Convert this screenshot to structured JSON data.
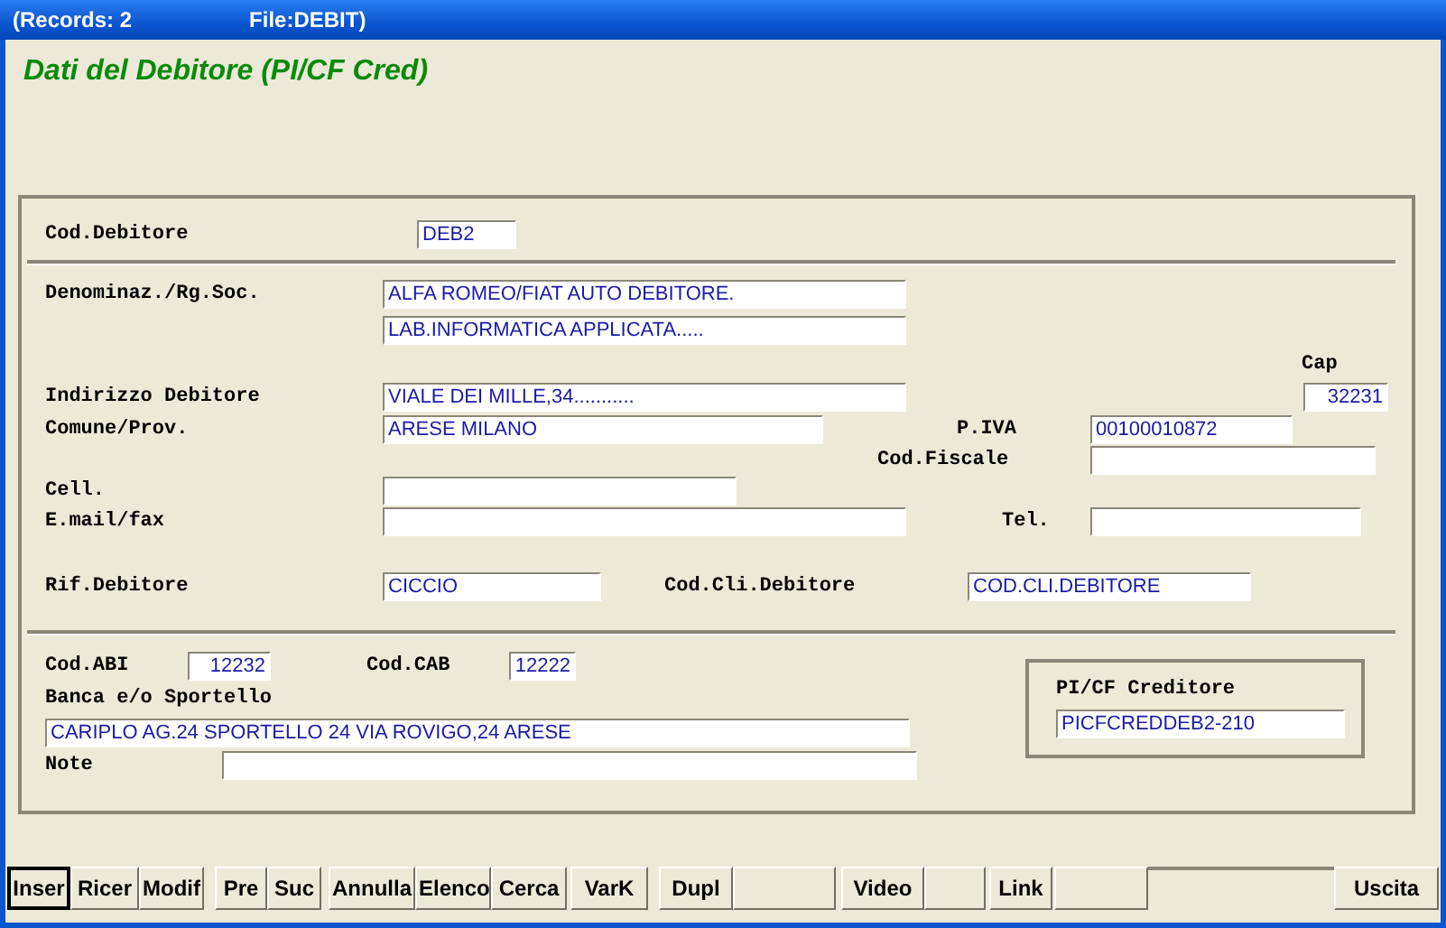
{
  "window": {
    "title_left": "(Records: 2",
    "title_right": "File:DEBIT)"
  },
  "heading": "Dati del Debitore (PI/CF Cred)",
  "form": {
    "cod_debitore": {
      "label": "Cod.Debitore",
      "value": "DEB2"
    },
    "denominazione": {
      "label": "Denominaz./Rg.Soc.",
      "value_1": "ALFA ROMEO/FIAT AUTO DEBITORE.",
      "value_2": "LAB.INFORMATICA APPLICATA....."
    },
    "cap": {
      "label": "Cap",
      "value": "32231"
    },
    "indirizzo": {
      "label": "Indirizzo Debitore",
      "value": "VIALE DEI MILLE,34..........."
    },
    "comune": {
      "label": "Comune/Prov.",
      "value": "ARESE MILANO"
    },
    "piva": {
      "label": "P.IVA",
      "value": "00100010872"
    },
    "cod_fiscale": {
      "label": "Cod.Fiscale"
    },
    "cell": {
      "label": "Cell."
    },
    "email": {
      "label": "E.mail/fax"
    },
    "tel": {
      "label": "Tel."
    },
    "rif_debitore": {
      "label": "Rif.Debitore",
      "value": "CICCIO"
    },
    "cod_cli": {
      "label": "Cod.Cli.Debitore",
      "value": "COD.CLI.DEBITORE"
    },
    "cod_abi": {
      "label": "Cod.ABI",
      "value": "12232"
    },
    "cod_cab": {
      "label": "Cod.CAB",
      "value": "12222"
    },
    "banca": {
      "label": "Banca e/o Sportello",
      "value": "CARIPLO AG.24 SPORTELLO 24 VIA ROVIGO,24 ARESE"
    },
    "note": {
      "label": "Note"
    },
    "creditore": {
      "label": "PI/CF Creditore",
      "value": "PICFCREDDEB2-210"
    }
  },
  "toolbar": [
    {
      "kind": "button",
      "label": "Inser",
      "selected": true
    },
    {
      "kind": "button",
      "label": "Ricer",
      "selected": false
    },
    {
      "kind": "button",
      "label": "Modif",
      "selected": false
    },
    {
      "kind": "button",
      "label": "Pre",
      "selected": false
    },
    {
      "kind": "button",
      "label": "Suc",
      "selected": false
    },
    {
      "kind": "button",
      "label": "Annulla",
      "selected": false
    },
    {
      "kind": "button",
      "label": "Elenco",
      "selected": false
    },
    {
      "kind": "button",
      "label": "Cerca",
      "selected": false
    },
    {
      "kind": "button",
      "label": "VarK",
      "selected": false
    },
    {
      "kind": "button",
      "label": "Dupl",
      "selected": false
    },
    {
      "kind": "blank",
      "selected": false
    },
    {
      "kind": "button",
      "label": "Video",
      "selected": false
    },
    {
      "kind": "blank",
      "selected": false
    },
    {
      "kind": "button",
      "label": "Link",
      "selected": false
    },
    {
      "kind": "blank",
      "selected": false
    },
    {
      "kind": "spacer",
      "selected": false
    },
    {
      "kind": "button",
      "label": "Uscita",
      "selected": false
    }
  ]
}
